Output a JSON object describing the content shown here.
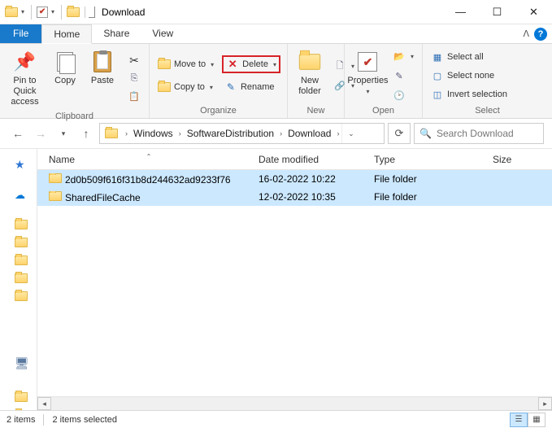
{
  "window": {
    "title": "Download"
  },
  "tabs": {
    "file": "File",
    "home": "Home",
    "share": "Share",
    "view": "View"
  },
  "ribbon": {
    "clipboard": {
      "label": "Clipboard",
      "pin": "Pin to Quick\naccess",
      "copy": "Copy",
      "paste": "Paste"
    },
    "organize": {
      "label": "Organize",
      "moveto": "Move to",
      "copyto": "Copy to",
      "delete": "Delete",
      "rename": "Rename"
    },
    "new": {
      "label": "New",
      "newfolder": "New\nfolder"
    },
    "open": {
      "label": "Open",
      "properties": "Properties"
    },
    "select": {
      "label": "Select",
      "all": "Select all",
      "none": "Select none",
      "invert": "Invert selection"
    }
  },
  "address": {
    "segments": [
      "Windows",
      "SoftwareDistribution",
      "Download"
    ]
  },
  "search": {
    "placeholder": "Search Download"
  },
  "columns": {
    "name": "Name",
    "date": "Date modified",
    "type": "Type",
    "size": "Size"
  },
  "files": [
    {
      "name": "2d0b509f616f31b8d244632ad9233f76",
      "date": "16-02-2022 10:22",
      "type": "File folder",
      "size": ""
    },
    {
      "name": "SharedFileCache",
      "date": "12-02-2022 10:35",
      "type": "File folder",
      "size": ""
    }
  ],
  "status": {
    "items": "2 items",
    "selected": "2 items selected"
  }
}
